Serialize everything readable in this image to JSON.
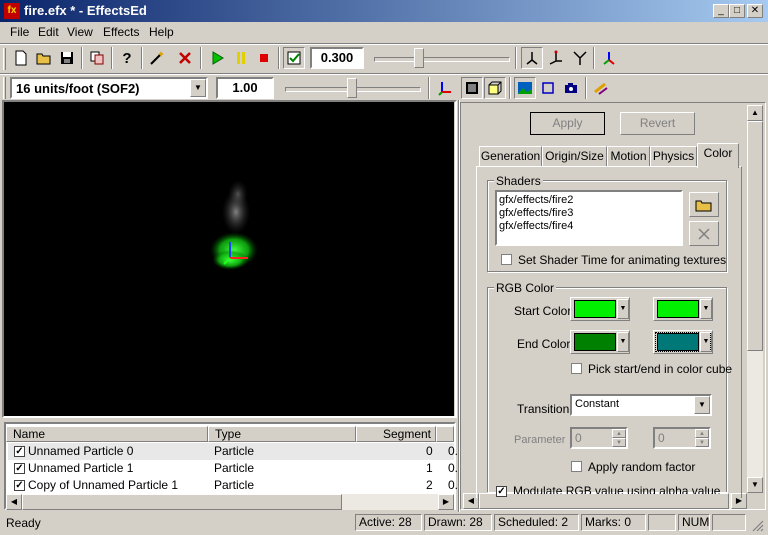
{
  "window": {
    "title": "fire.efx * - EffectsEd",
    "app_icon": "fx"
  },
  "menu": [
    "File",
    "Edit",
    "View",
    "Effects",
    "Help"
  ],
  "toolbar1": {
    "time_value": "0.300",
    "slider_level": 0.32
  },
  "toolbar2": {
    "units_selected": "16 units/foot (SOF2)",
    "scale_value": "1.00",
    "slider_level": 0.5
  },
  "particle_list": {
    "columns": [
      "Name",
      "Type",
      "Segment"
    ],
    "rows": [
      {
        "name": "Unnamed Particle 0",
        "type": "Particle",
        "segment": "0",
        "extra": "0.",
        "checked": true
      },
      {
        "name": "Unnamed Particle 1",
        "type": "Particle",
        "segment": "1",
        "extra": "0.",
        "checked": true
      },
      {
        "name": "Copy of Unnamed Particle 1",
        "type": "Particle",
        "segment": "2",
        "extra": "0.",
        "checked": true
      }
    ]
  },
  "panel": {
    "apply_label": "Apply",
    "revert_label": "Revert",
    "tabs": [
      "Generation",
      "Origin/Size",
      "Motion",
      "Physics",
      "Color"
    ],
    "active_tab": "Color",
    "shaders": {
      "group_label": "Shaders",
      "items": [
        "gfx/effects/fire2",
        "gfx/effects/fire3",
        "gfx/effects/fire4"
      ],
      "shader_time_label": "Set Shader Time for animating textures"
    },
    "rgb": {
      "group_label": "RGB Color",
      "start_label": "Start Color",
      "end_label": "End Color",
      "start_color_1": "#00f000",
      "start_color_2": "#00f000",
      "end_color_1": "#008000",
      "end_color_2": "#007878",
      "pick_cube_label": "Pick start/end in color cube",
      "transition_label": "Transition",
      "transition_value": "Constant",
      "parameter_label": "Parameter",
      "param1": "0",
      "param2": "0",
      "random_factor_label": "Apply random factor",
      "modulate_label": "Modulate RGB value using alpha value"
    }
  },
  "status": {
    "ready": "Ready",
    "active": "Active: 28",
    "drawn": "Drawn: 28",
    "scheduled": "Scheduled: 2",
    "marks": "Marks: 0",
    "num": "NUM"
  },
  "colors": {
    "titlebar_start": "#0a246a",
    "titlebar_end": "#a6caf0",
    "face": "#d4d0c8",
    "viewport_bg": "#000000"
  }
}
